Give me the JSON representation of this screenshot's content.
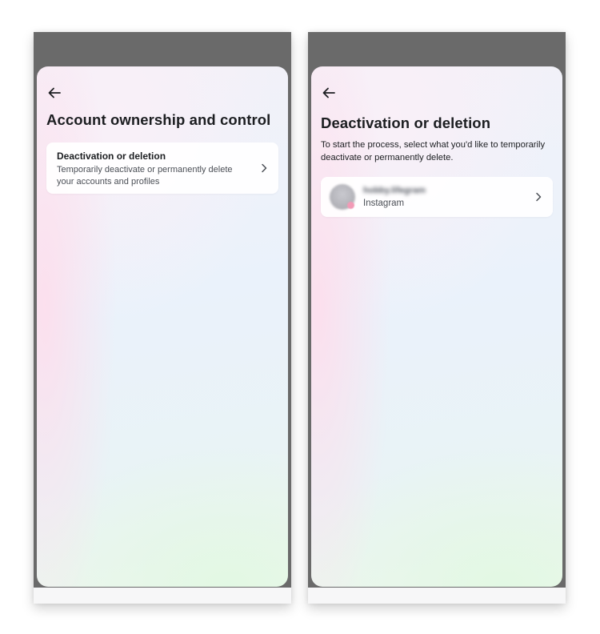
{
  "screens": {
    "left": {
      "title": "Account ownership and control",
      "option": {
        "title": "Deactivation or deletion",
        "description": "Temporarily deactivate or permanently delete your accounts and profiles"
      }
    },
    "right": {
      "title": "Deactivation or deletion",
      "subtitle": "To start the process, select what you'd like to temporarily deactivate or permanently delete.",
      "account": {
        "username": "hobby.lifegram",
        "platform": "Instagram"
      }
    }
  },
  "icons": {
    "back": "back-arrow-icon",
    "chevron": "chevron-right-icon",
    "avatar": "avatar"
  },
  "colors": {
    "text_primary": "#1c1e21",
    "text_secondary": "#4b4f56",
    "phone_frame": "#6a6a6a",
    "card_background": "#ffffff"
  }
}
